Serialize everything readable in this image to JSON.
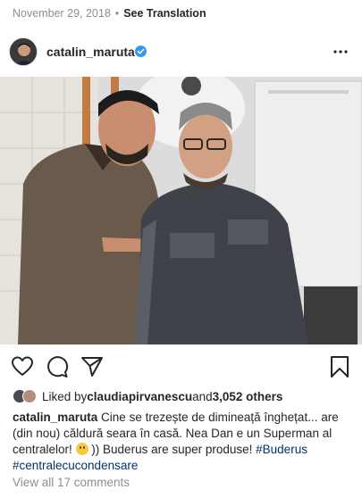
{
  "post": {
    "date": "November 29, 2018",
    "separator": "•",
    "see_translation": "See Translation",
    "username": "catalin_maruta",
    "verified_icon": "verified-badge-icon",
    "more_icon": "more-options-icon"
  },
  "actions": {
    "like_icon": "heart-icon",
    "comment_icon": "comment-icon",
    "share_icon": "share-icon",
    "save_icon": "bookmark-icon"
  },
  "likes": {
    "prefix": "Liked by ",
    "user": "claudiapirvanescu",
    "middle": " and ",
    "count": "3,052 others"
  },
  "caption": {
    "username": "catalin_maruta",
    "text_part1": " Cine se trezește de dimineață înghețat... are (din nou) căldură seara în casă. Nea Dan e un Superman al centralelor! ",
    "text_part2": " )) Buderus are super produse! ",
    "emoji_icon": "smiling-face-emoji",
    "hashtag1": "#Buderus",
    "hashtag2": "#centralecucondensare"
  },
  "comments": {
    "view_all": "View all 17 comments"
  },
  "colors": {
    "text": "#262626",
    "muted": "#8e8e8e",
    "hashtag": "#003569",
    "verified": "#3897f0"
  }
}
